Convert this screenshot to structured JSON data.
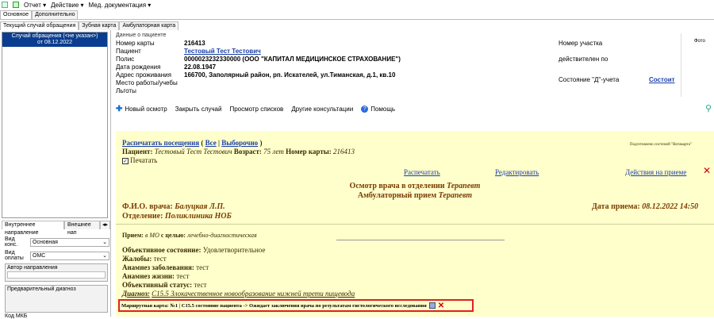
{
  "menu": {
    "items": [
      "Отчет ▾",
      "Действие ▾",
      "Мед. документация ▾"
    ]
  },
  "main_tabs": [
    "Основное",
    "Дополнительно"
  ],
  "sub_tabs": [
    "Текущий случай обращения",
    "Зубная карта",
    "Амбулаторная карта"
  ],
  "case_list": {
    "item": "Случай обращения (<не указан>)\nот 08.12.2022"
  },
  "left_tabs": [
    "Внутреннее направление",
    "Внешнее нап"
  ],
  "consult_type": {
    "label": "Вид конс.",
    "value": "Основная"
  },
  "payment_type": {
    "label": "Вид оплаты",
    "value": "ОМС"
  },
  "referral_author": {
    "label": "Автор направления"
  },
  "pre_diagnosis": {
    "label": "Предварительный диагноз"
  },
  "mkb_label": "Код МКБ",
  "patient": {
    "section_title": "Данные о пациенте",
    "card_label": "Номер карты",
    "card": "216413",
    "patient_label": "Пациент",
    "name": "Тестовый Тест Тестович",
    "policy_label": "Полис",
    "policy": " 0000023232330000 (ООО \"КАПИТАЛ МЕДИЦИНСКОЕ СТРАХОВАНИЕ\")",
    "dob_label": "Дата рождения",
    "dob": "22.08.1947",
    "address_label": "Адрес проживания",
    "address": "166700, Заполярный район, рп. Искателей, ул.Тиманская, д.1, кв.10",
    "work_label": "Место работы/учебы",
    "benefits_label": "Льготы",
    "district_label": "Номер участка",
    "valid_label": "действителен по",
    "d_label": "Состояние \"Д\"-учета",
    "d_link": "Состоит",
    "photo_label": "Фото"
  },
  "toolbar": {
    "new_visit": "Новый осмотр",
    "close_case": "Закрыть случай",
    "view_lists": "Просмотр списков",
    "other": "Другие консультации",
    "help": "Помощь"
  },
  "doc": {
    "print_visits": "Распечатать посещения",
    "all": "Все",
    "selective": "Выборочно",
    "system_note": "Подготовлено системой \"Витакарта\"",
    "patient_label": "Пациент:",
    "patient_name": "Тестовый Тест Тестович",
    "age_label": "Возраст:",
    "age": "75 лет",
    "card_label": "Номер карты:",
    "card": "216413",
    "print_check": "Печатать",
    "print_link": "Распечатать",
    "edit_link": "Редактировать",
    "actions_link": "Действия на приеме",
    "exam_title": "Осмотр врача в отделении",
    "exam_dept": "Терапевт",
    "visit_type": "Амбулаторный прием",
    "visit_spec": "Терапевт",
    "doctor_label": "Ф.И.О. врача:",
    "doctor": "Балуцкая Л.П.",
    "date_label": "Дата приема:",
    "date": "08.12.2022 14:50",
    "dept_label": "Отделение:",
    "dept": "Поликлиника НОБ",
    "reception_label": "Прием:",
    "reception_in": "в МО",
    "reception_goal_label": "с целью:",
    "reception_goal": "лечебно-диагностическая",
    "state_label": "Объективное состояние:",
    "state": "Удовлетворительное",
    "complaints_label": "Жалобы:",
    "complaints": "тест",
    "anamnesis_label": "Анамнез заболевания:",
    "anamnesis": "тест",
    "life_label": "Анамнез жизни:",
    "life": "тест",
    "status_label": "Объективный статус:",
    "status": "тест",
    "diag_label": "Диагноз:",
    "diag": "C15.5 Злокачественное новообразование нижней трети пищевода",
    "route": "Маршрутная карта: №1 | C15.5 состояние пациента -> Ожидает заключения врача по результатам гистологического исследования"
  }
}
